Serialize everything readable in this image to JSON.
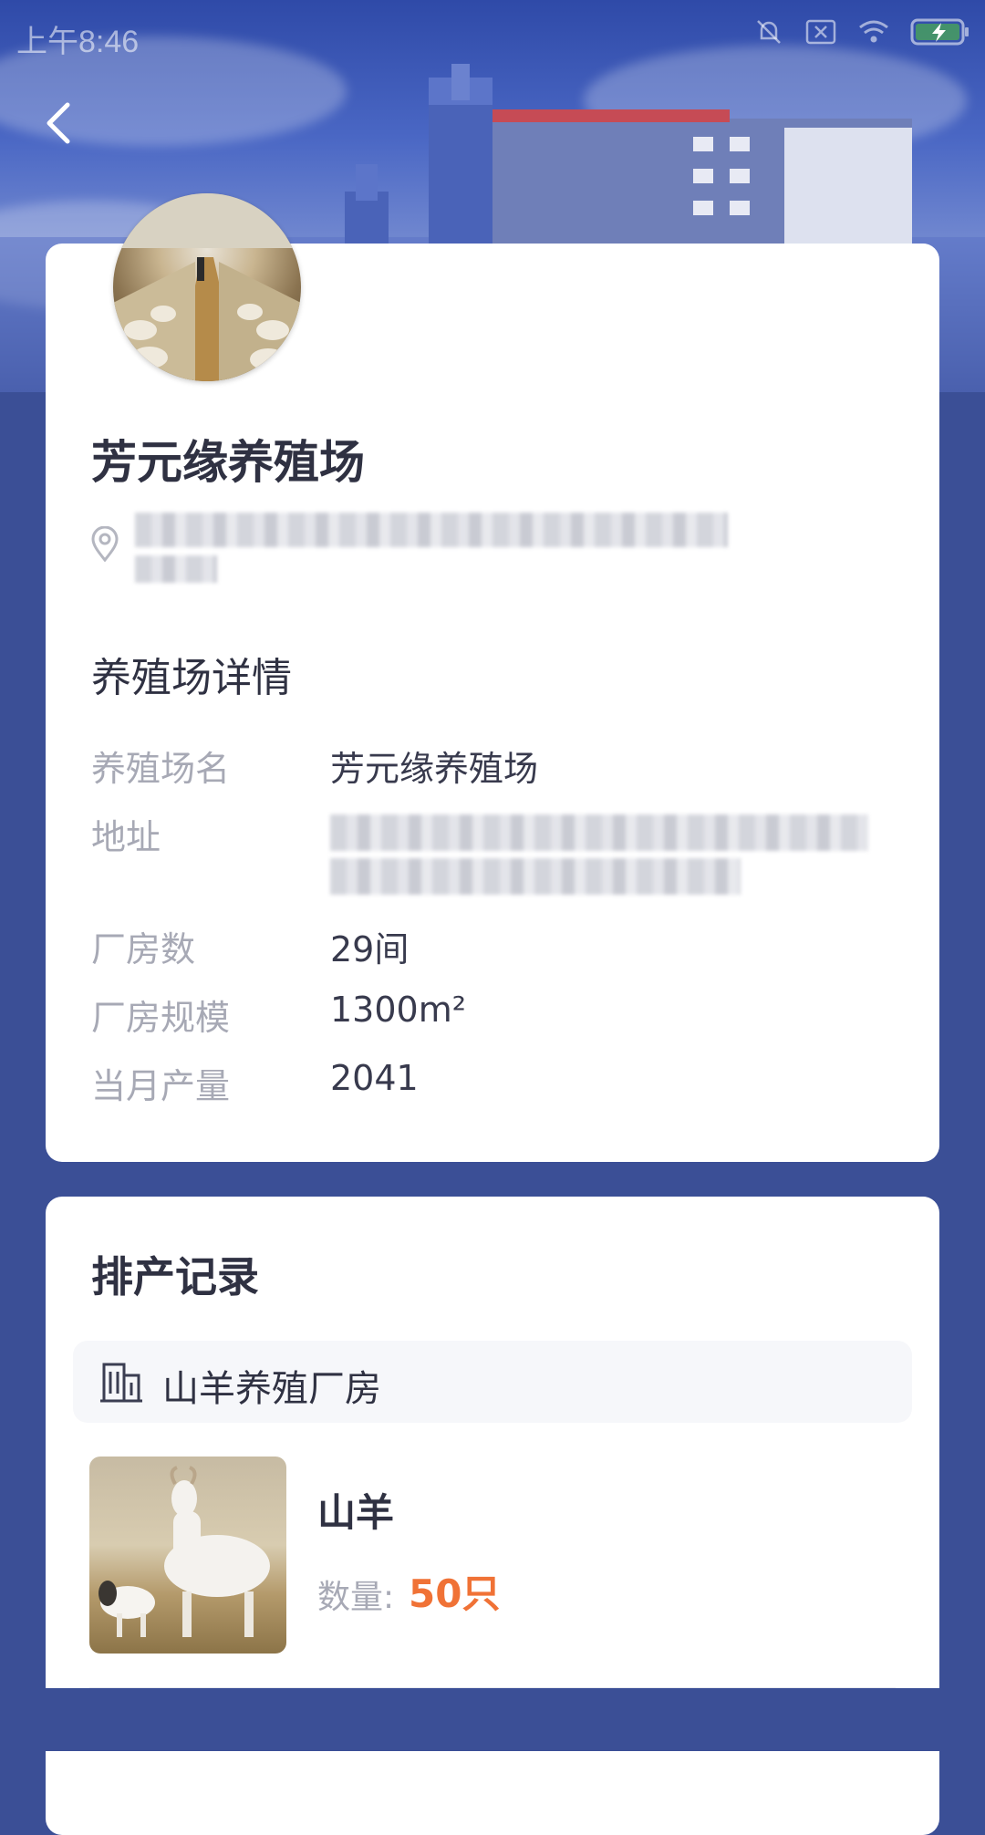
{
  "statusbar": {
    "time": "上午8:46"
  },
  "header": {
    "back_icon": "chevron-left-icon"
  },
  "farm": {
    "name": "芳元缘养殖场",
    "location_icon": "location-pin-icon",
    "address_obscured": true
  },
  "details": {
    "title": "养殖场详情",
    "rows": [
      {
        "label": "养殖场名",
        "value": "芳元缘养殖场"
      },
      {
        "label": "地址",
        "value": ""
      },
      {
        "label": "厂房数",
        "value": "29间"
      },
      {
        "label": "厂房规模",
        "value": "1300m²"
      },
      {
        "label": "当月产量",
        "value": "2041"
      }
    ]
  },
  "production": {
    "title": "排产记录",
    "house": {
      "icon": "building-icon",
      "label": "山羊养殖厂房"
    },
    "items": [
      {
        "name": "山羊",
        "qty_label": "数量:",
        "qty_value": "50只"
      }
    ]
  },
  "colors": {
    "accent": "#f07236",
    "background": "#3b4f96",
    "card": "#ffffff"
  }
}
